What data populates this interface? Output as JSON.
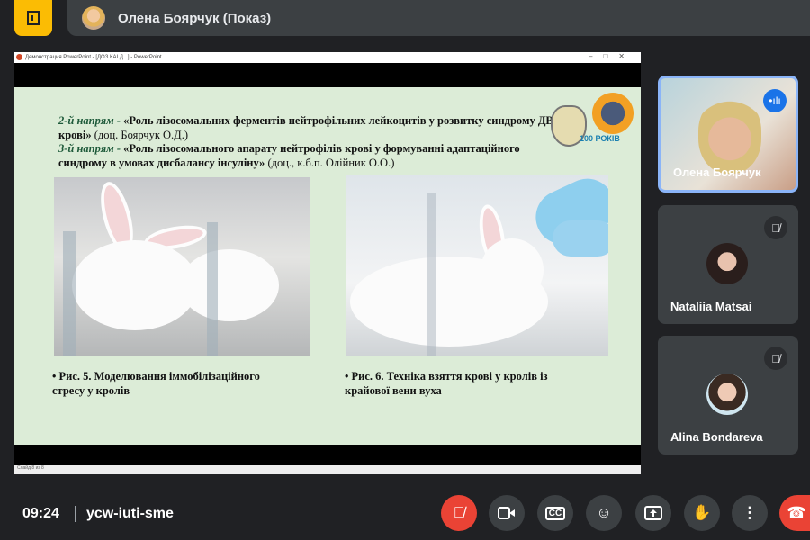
{
  "header": {
    "presenter_label": "Олена Боярчук (Показ)"
  },
  "powerpoint": {
    "window_title": "Демонстрация PowerPoint - [ДОЗ КАІ Д...] - PowerPoint",
    "status_left": "Слайд 8 из 8",
    "slide": {
      "direction2_label": "2-й напрям -",
      "direction2_title": "«Роль лізосомальних ферментів нейтрофільних лейкоцитів у розвитку синдрому ДВЗ крові»",
      "direction2_author": "(доц. Боярчук О.Д.)",
      "direction3_label": "3-й напрям -",
      "direction3_title": "«Роль лізосомального апарату нейтрофілів крові у формуванні адаптаційного синдрому в умовах дисбалансу інсуліну»",
      "direction3_author": "(доц., к.б.п. Олійник О.О.)",
      "logo_text": "100 РОКІВ",
      "caption1": "Рис. 5. Моделювання іммобілізаційного стресу у кролів",
      "caption2": "Рис. 6. Техніка взяття крові у кролів із крайової вени вуха"
    }
  },
  "participants": [
    {
      "name": "Олена Боярчук",
      "speaking": true
    },
    {
      "name": "Nataliia Matsai",
      "muted": true
    },
    {
      "name": "Alina Bondareva",
      "muted": true
    }
  ],
  "footer": {
    "time": "09:24",
    "meeting_code": "ycw-iuti-sme"
  },
  "colors": {
    "accent": "#8ab4f8",
    "danger": "#ea4335",
    "bg": "#202124"
  }
}
